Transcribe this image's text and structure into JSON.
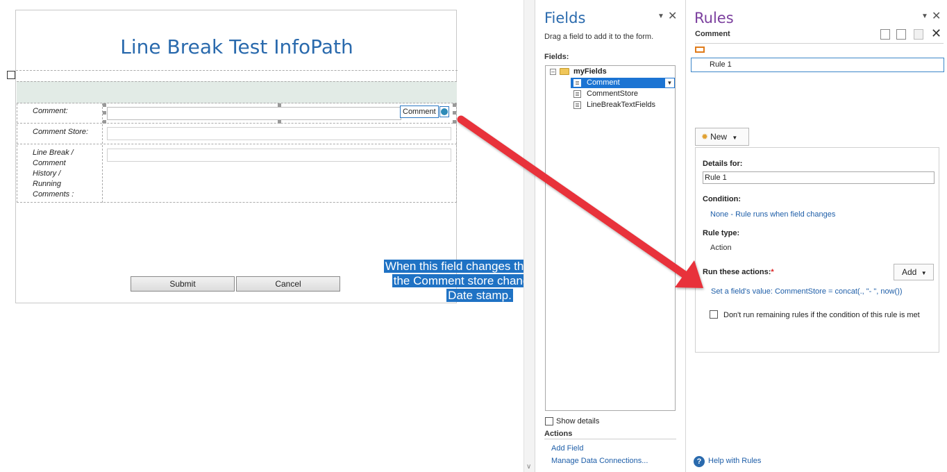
{
  "form": {
    "title": "Line Break Test InfoPath",
    "rows": [
      {
        "label": "Comment:"
      },
      {
        "label": "Comment Store:"
      },
      {
        "label": "Line Break /\nComment\nHistory /\nRunning\nComments :"
      }
    ],
    "field_tag": "Comment",
    "submit_label": "Submit",
    "cancel_label": "Cancel"
  },
  "callout": {
    "text": "When this field changes the value in the Comment store changes with Date stamp.",
    "lines": [
      "When this field changes the value in",
      "the Comment store changes with",
      "Date stamp."
    ],
    "bg_color": "#1f72c4",
    "arrow_color": "#e8323a"
  },
  "fields_pane": {
    "title": "Fields",
    "hint": "Drag a field to add it to the form.",
    "fields_label": "Fields:",
    "tree": {
      "group": "myFields",
      "items": [
        {
          "name": "Comment",
          "selected": true
        },
        {
          "name": "CommentStore",
          "selected": false
        },
        {
          "name": "LineBreakTextFields",
          "selected": false
        }
      ]
    },
    "show_details": "Show details",
    "actions_label": "Actions",
    "actions": [
      "Add Field",
      "Manage Data Connections..."
    ]
  },
  "rules_pane": {
    "title": "Rules",
    "field_name": "Comment",
    "rules": [
      "Rule 1"
    ],
    "new_label": "New",
    "details_for_label": "Details for:",
    "details_for_value": "Rule 1",
    "condition_label": "Condition:",
    "condition_value": "None - Rule runs when field changes",
    "rule_type_label": "Rule type:",
    "rule_type_value": "Action",
    "run_actions_label": "Run these actions:",
    "required_mark": "*",
    "add_label": "Add",
    "action_value": "Set a field's value: CommentStore = concat(., \"- \", now())",
    "stop_rules_label": "Don't run remaining rules if the condition of this rule is met",
    "help_label": "Help with Rules"
  },
  "icons": {
    "close": "close-icon",
    "dropdown": "chevron-down-icon",
    "copy": "copy-icon",
    "paste": "paste-icon",
    "delete": "delete-icon",
    "help": "help-icon",
    "folder": "folder-icon",
    "field": "field-icon"
  }
}
